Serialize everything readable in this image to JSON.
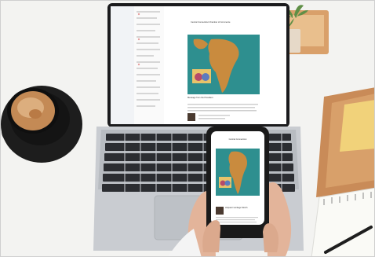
{
  "scene": {
    "objects": [
      "laptop",
      "smartphone",
      "coffee-cup",
      "saucer",
      "succulent-plant",
      "wooden-box",
      "notepad",
      "sticky-notes",
      "pen"
    ],
    "colors": {
      "desk": "#f3f3f1",
      "laptop_body": "#c9ccd1",
      "keyboard": "#2b2d31",
      "coffee_cup": "#1d1d1d",
      "coffee": "#c48a55",
      "sticky_note": "#f1d27a",
      "map_sea": "#2e8f8f",
      "map_land": "#c98b3e"
    }
  },
  "laptop_screen": {
    "email_header_line1": "Central Connecticut Chamber of Commerce",
    "email_body_heading": "Message from the President"
  },
  "phone_screen": {
    "header_text": "Central Connecticut",
    "caption": "Hispanic Heritage Month"
  }
}
